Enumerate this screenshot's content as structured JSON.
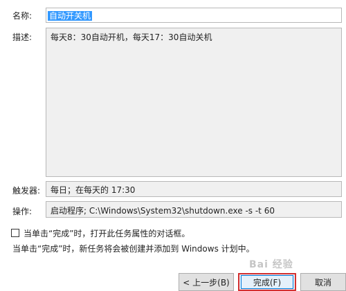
{
  "form": {
    "name_label": "名称:",
    "name_value": "自动开关机",
    "desc_label": "描述:",
    "desc_value": "每天8：30自动开机，每天17：30自动关机",
    "trigger_label": "触发器:",
    "trigger_value": "每日；在每天的 17:30",
    "action_label": "操作:",
    "action_value": "启动程序; C:\\Windows\\System32\\shutdown.exe -s -t 60"
  },
  "options": {
    "open_properties_label": "当单击“完成”时，打开此任务属性的对话框。",
    "open_properties_checked": false,
    "info_text": "当单击“完成”时，新任务将会被创建并添加到 Windows 计划中。"
  },
  "buttons": {
    "back": "< 上一步(B)",
    "finish": "完成(F)",
    "cancel": "取消"
  },
  "watermark": "Bai 经验"
}
